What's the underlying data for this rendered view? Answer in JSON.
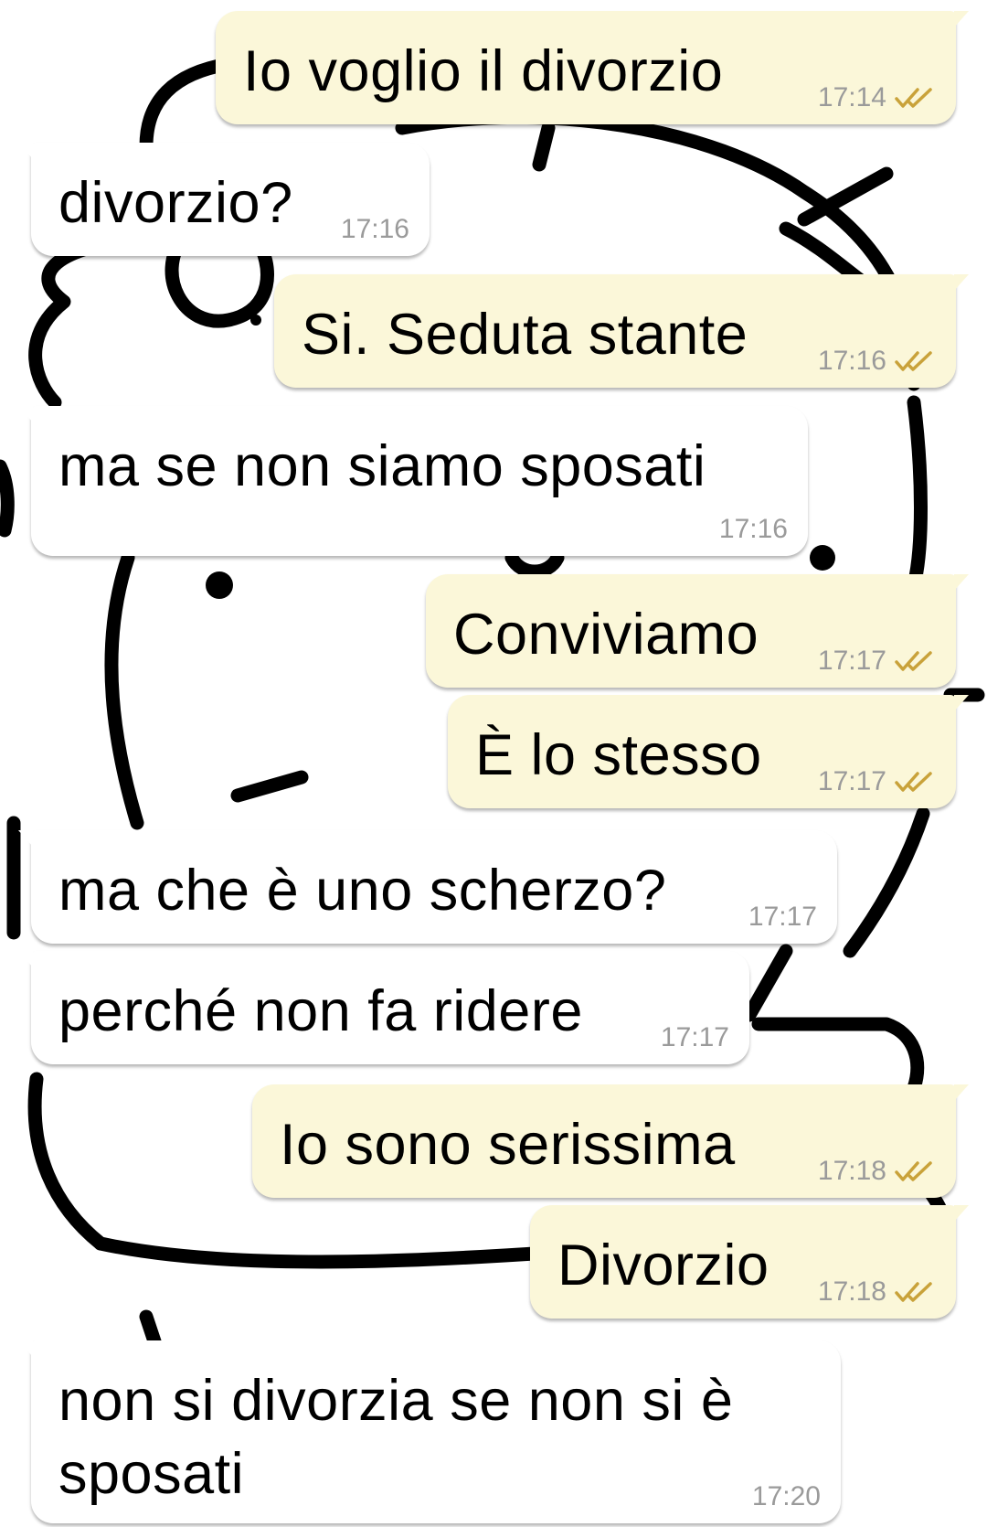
{
  "conversation": {
    "messages": [
      {
        "direction": "out",
        "text": "Io voglio il divorzio",
        "time": "17:14",
        "status": "read"
      },
      {
        "direction": "in",
        "text": "divorzio?",
        "time": "17:16"
      },
      {
        "direction": "out",
        "text": "Si. Seduta stante",
        "time": "17:16",
        "status": "read"
      },
      {
        "direction": "in",
        "text": "ma se non siamo sposati",
        "time": "17:16"
      },
      {
        "direction": "out",
        "text": "Conviviamo",
        "time": "17:17",
        "status": "read"
      },
      {
        "direction": "out",
        "text": "È lo stesso",
        "time": "17:17",
        "status": "read"
      },
      {
        "direction": "in",
        "text": "ma che è uno scherzo?",
        "time": "17:17"
      },
      {
        "direction": "in",
        "text": "perché non fa ridere",
        "time": "17:17"
      },
      {
        "direction": "out",
        "text": "Io sono serissima",
        "time": "17:18",
        "status": "read"
      },
      {
        "direction": "out",
        "text": "Divorzio",
        "time": "17:18",
        "status": "read"
      },
      {
        "direction": "in",
        "text": "non si divorzia se non si è sposati",
        "time": "17:20"
      }
    ]
  },
  "colors": {
    "outgoing_bubble": "#fbf7d9",
    "incoming_bubble": "#ffffff",
    "timestamp": "#9a9a9a",
    "read_ticks": "#c9a23a",
    "wallpaper_ink": "#000000"
  },
  "icons": {
    "read_receipt": "double-check-icon"
  }
}
